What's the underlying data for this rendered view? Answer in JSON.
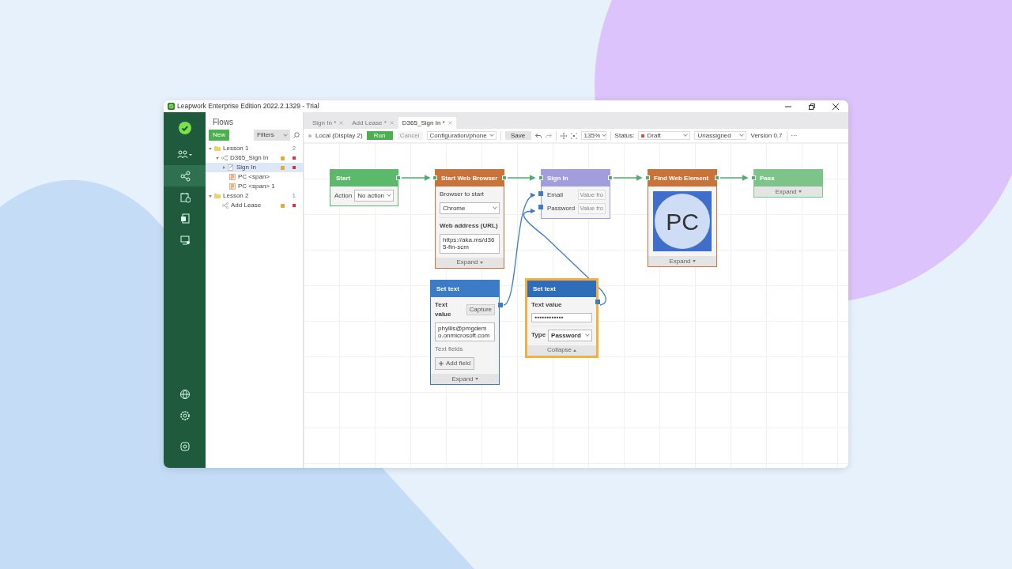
{
  "window": {
    "title": "Leapwork Enterprise Edition 2022.2.1329 - Trial"
  },
  "sidebar": {
    "items": [
      {
        "kind": "people",
        "selected": false
      },
      {
        "kind": "flow",
        "selected": true
      },
      {
        "kind": "schedule",
        "selected": false
      },
      {
        "kind": "report",
        "selected": false
      },
      {
        "kind": "agent",
        "selected": false
      }
    ],
    "bottom_items": [
      {
        "kind": "globe",
        "selected": false
      },
      {
        "kind": "settings",
        "selected": false
      },
      {
        "kind": "help",
        "selected": false
      }
    ]
  },
  "flows": {
    "title": "Flows",
    "new_button": "New",
    "filter": "Filters",
    "tree": [
      {
        "label": "Lesson 1",
        "kind": "folder",
        "count": "2",
        "expanded": true,
        "selected": false,
        "children": [
          {
            "label": "D365_Sign In",
            "kind": "flow",
            "expanded": true,
            "selected": false,
            "locked": true,
            "color": "#d9343a",
            "children": [
              {
                "label": "Sign In",
                "kind": "step",
                "expanded": false,
                "selected": true,
                "locked": true,
                "color": "#d9343a"
              },
              {
                "label": "PC <span>",
                "kind": "element",
                "selected": false
              },
              {
                "label": "PC <span> 1",
                "kind": "element",
                "selected": false
              }
            ]
          }
        ]
      },
      {
        "label": "Lesson 2",
        "kind": "folder",
        "count": "1",
        "expanded": true,
        "selected": false,
        "children": [
          {
            "label": "Add Lease",
            "kind": "flow",
            "selected": false,
            "locked": true,
            "color": "#d9343a"
          }
        ]
      }
    ]
  },
  "tabs": [
    {
      "label": "Sign In *",
      "selected": false
    },
    {
      "label": "Add Lease *",
      "selected": false
    },
    {
      "label": "D365_Sign In *",
      "selected": true
    }
  ],
  "toolbar": {
    "agent": "Local (Display 2)",
    "run": "Run",
    "cancel": {
      "label": "Cancel",
      "disabled": true
    },
    "configuration": "Configuration/phone",
    "save": "Save",
    "zoom": "135%",
    "status_label": "Status:",
    "status": {
      "value": "Draft",
      "color": "#e04848"
    },
    "assignee": "Unassigned",
    "version": "Version 0.7",
    "more": "···"
  },
  "nodes": [
    {
      "title": "Start",
      "color": "#5cb86a",
      "selected": false,
      "fields": [
        {
          "kind": "inline-select",
          "label": "Action",
          "value": "No action"
        }
      ]
    },
    {
      "title": "Start Web Browser",
      "color": "#c8733a",
      "selected": false,
      "fields": [
        {
          "kind": "select",
          "label": "Browser to start",
          "value": "Chrome"
        },
        {
          "kind": "textarea",
          "label": "Web address (URL)",
          "value": "https://aka.ms/d365-fin-scm"
        }
      ],
      "footer": {
        "label": "Expand",
        "expanded": false
      }
    },
    {
      "title": "Sign In",
      "color": "#a29ddc",
      "selected": false,
      "fields": [
        {
          "kind": "port",
          "label": "Email",
          "button": "Value fro"
        },
        {
          "kind": "port",
          "label": "Password",
          "button": "Value fro"
        }
      ]
    },
    {
      "title": "Find Web Element",
      "color": "#c8733a",
      "selected": false,
      "fields": [
        {
          "kind": "image",
          "text": "PC"
        }
      ],
      "footer": {
        "label": "Expand",
        "expanded": false
      }
    },
    {
      "title": "Pass",
      "color": "#7cc48a",
      "selected": false,
      "footer": {
        "label": "Expand",
        "expanded": false
      }
    },
    {
      "title": "Set text",
      "color": "#3b7cc4",
      "selected": false,
      "fields": [
        {
          "kind": "capture",
          "label": "Text value",
          "button": "Capture",
          "value": "phyllis@pmgdemo.onmicrosoft.com"
        },
        {
          "kind": "label",
          "label": "Text fields"
        },
        {
          "kind": "add",
          "label": "Add field"
        }
      ],
      "footer": {
        "label": "Expand",
        "expanded": false
      }
    },
    {
      "title": "Set text",
      "color": "#2f6db8",
      "selected": true,
      "fields": [
        {
          "kind": "password",
          "label": "Text value",
          "value": "●●●●●●●●●●●●"
        },
        {
          "kind": "inline-select",
          "label": "Type",
          "value": "Password"
        }
      ],
      "footer": {
        "label": "Collapse",
        "expanded": true
      }
    }
  ]
}
